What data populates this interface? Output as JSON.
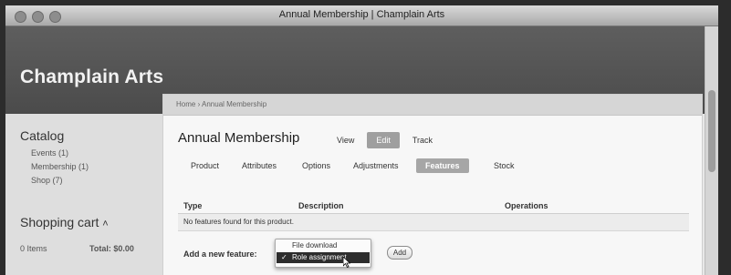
{
  "window": {
    "title": "Annual Membership | Champlain Arts"
  },
  "site": {
    "name": "Champlain Arts"
  },
  "sidebar": {
    "catalog_heading": "Catalog",
    "catalog_items": [
      {
        "label": "Events (1)"
      },
      {
        "label": "Membership (1)"
      },
      {
        "label": "Shop (7)"
      }
    ],
    "cart_heading": "Shopping cart",
    "cart_items": "0 Items",
    "cart_total": "Total: $0.00"
  },
  "breadcrumb": "Home › Annual Membership",
  "product": {
    "title": "Annual Membership",
    "actions": {
      "view": "View",
      "edit": "Edit",
      "track": "Track"
    }
  },
  "subtabs": {
    "product": "Product",
    "attributes": "Attributes",
    "options": "Options",
    "adjustments": "Adjustments",
    "features": "Features",
    "stock": "Stock"
  },
  "table": {
    "headers": [
      "Type",
      "Description",
      "Operations"
    ],
    "empty_message": "No features found for this product."
  },
  "add_feature": {
    "label": "Add a new feature:",
    "options": [
      "File download",
      "Role assignment"
    ],
    "selected": "Role assignment",
    "button": "Add"
  }
}
